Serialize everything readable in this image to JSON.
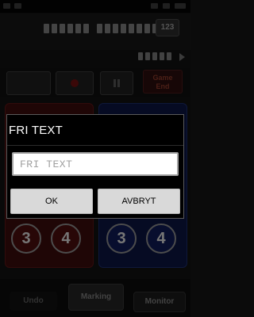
{
  "background_app": {
    "counter_label": "123",
    "game_end_label": "Game\nEnd",
    "team_red_buttons": [
      "3",
      "4"
    ],
    "team_blue_buttons": [
      "3",
      "4"
    ],
    "bottom_tabs": {
      "left": "Undo",
      "center": "Marking",
      "right": "Monitor"
    }
  },
  "dialog": {
    "title": "FRI TEXT",
    "input_placeholder": "FRI TEXT",
    "input_value": "",
    "ok_label": "OK",
    "cancel_label": "AVBRYT"
  },
  "colors": {
    "dialog_bg": "#000000",
    "button_bg": "#d9d9d9",
    "team_red": "#4a0d0d",
    "team_blue": "#0f1a55"
  }
}
